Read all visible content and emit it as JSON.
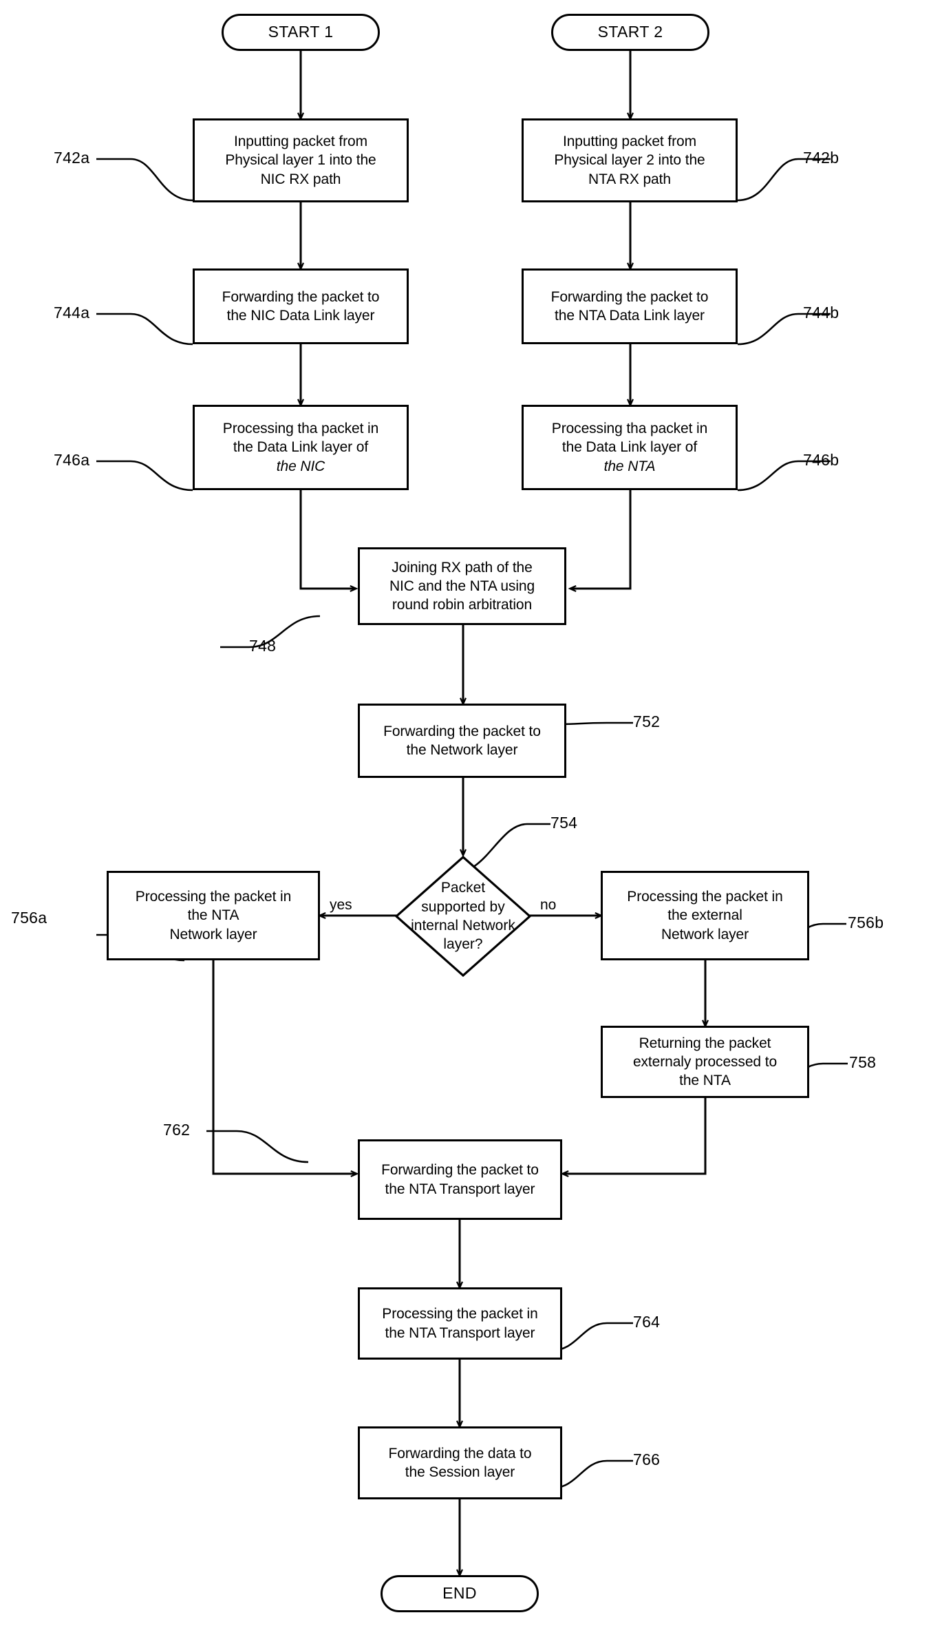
{
  "diagram": {
    "type": "flowchart",
    "title": "",
    "terminators": {
      "start_1": "START 1",
      "start_2": "START 2",
      "end": "END"
    },
    "edge_labels": {
      "yes": "yes",
      "no": "no"
    },
    "nodes": {
      "n742a": {
        "ref": "742a",
        "lines": [
          "Inputting packet from",
          "Physical layer 1 into the",
          "NIC RX path"
        ]
      },
      "n742b": {
        "ref": "742b",
        "lines": [
          "Inputting packet from",
          "Physical layer 2 into the",
          "NTA RX path"
        ]
      },
      "n744a": {
        "ref": "744a",
        "lines": [
          "Forwarding the packet to",
          "the NIC Data Link layer"
        ]
      },
      "n744b": {
        "ref": "744b",
        "lines": [
          "Forwarding the packet to",
          "the NTA Data Link layer"
        ]
      },
      "n746a": {
        "ref": "746a",
        "lines": [
          "Processing tha packet in",
          "the Data Link layer of"
        ],
        "italic_line": "the NIC"
      },
      "n746b": {
        "ref": "746b",
        "lines": [
          "Processing tha packet in",
          "the Data Link layer of"
        ],
        "italic_line": "the NTA"
      },
      "n748": {
        "ref": "748",
        "lines": [
          "Joining RX path of the",
          "NIC and the NTA using",
          "round robin arbitration"
        ]
      },
      "n752": {
        "ref": "752",
        "lines": [
          "Forwarding the packet to",
          "the Network layer"
        ]
      },
      "n754": {
        "ref": "754",
        "lines": [
          "Packet",
          "supported by",
          "internal Network",
          "layer?"
        ]
      },
      "n756a": {
        "ref": "756a",
        "lines": [
          "Processing the packet in",
          "the NTA",
          "Network layer"
        ]
      },
      "n756b": {
        "ref": "756b",
        "lines": [
          "Processing the packet in",
          "the external",
          "Network layer"
        ]
      },
      "n758": {
        "ref": "758",
        "lines": [
          "Returning the packet",
          "externaly processed to",
          "the NTA"
        ]
      },
      "n762": {
        "ref": "762",
        "lines": [
          "Forwarding the packet to",
          "the NTA Transport layer"
        ]
      },
      "n764": {
        "ref": "764",
        "lines": [
          "Processing the packet in",
          "the NTA Transport layer"
        ]
      },
      "n766": {
        "ref": "766",
        "lines": [
          "Forwarding the data to",
          "the Session layer"
        ]
      }
    },
    "colors": {
      "stroke": "#000000",
      "fill": "#ffffff"
    }
  }
}
